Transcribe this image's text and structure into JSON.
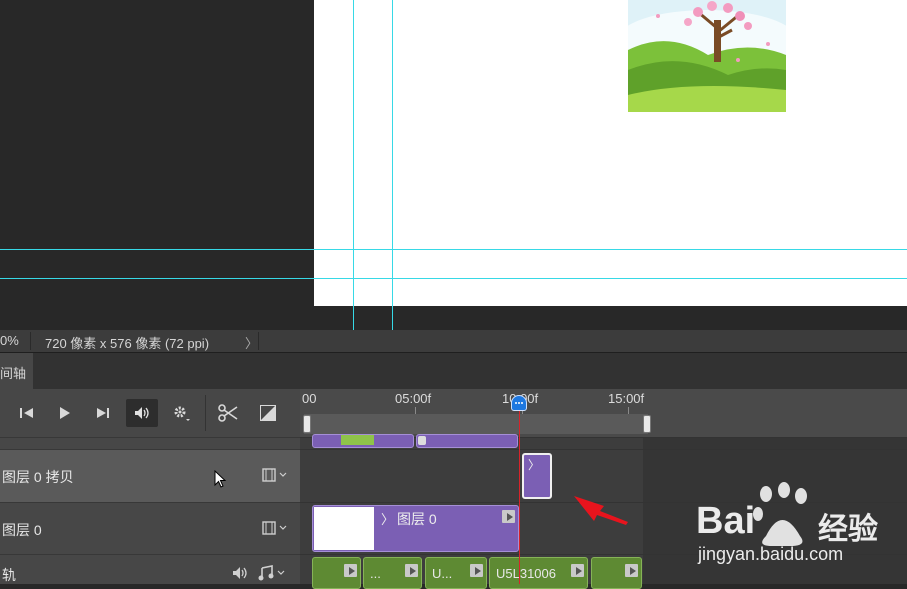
{
  "status_bar": {
    "zoom": "0%",
    "doc_info": "720 像素 x 576 像素 (72 ppi)",
    "arrow": "〉"
  },
  "panel": {
    "tab_label": "间轴"
  },
  "controls": {
    "icons": [
      "go-to-first-frame-icon",
      "play-icon",
      "go-to-next-frame-icon",
      "audio-icon",
      "settings-icon",
      "split-clip-icon",
      "transition-icon"
    ]
  },
  "ruler": {
    "labels": [
      "00",
      "05:00f",
      "10:00f",
      "15:00f"
    ]
  },
  "tracks": {
    "layer_copy_name": "图层 0 拷贝",
    "layer_name": "图层 0",
    "audio_name": "轨",
    "clip_label": "图层 0",
    "clip_arrow": "〉",
    "audio_clips": [
      "...",
      "U...",
      "U5L31006"
    ]
  },
  "watermark": {
    "brand_left": "Bai",
    "brand_right": "经验",
    "url": "jingyan.baidu.com"
  },
  "colors": {
    "accent_guide": "#37d9e6",
    "clip_video": "#7b5fb4",
    "clip_audio": "#5e8a33",
    "playhead": "#d8232a",
    "annotation_arrow": "#e8141d"
  }
}
